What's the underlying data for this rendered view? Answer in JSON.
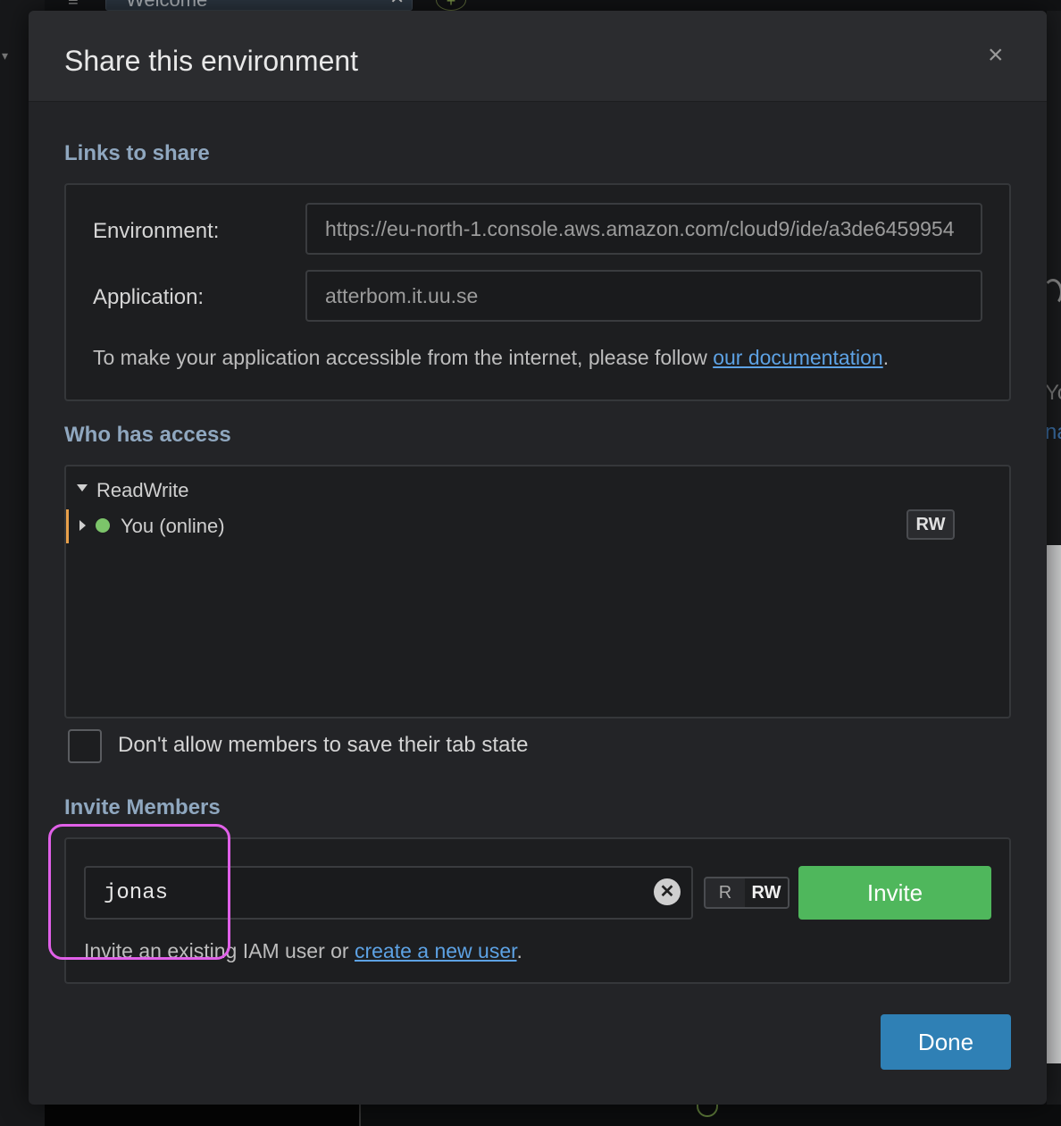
{
  "background": {
    "tab_title": "Welcome",
    "tab_close": "✕",
    "new_tab_symbol": "+",
    "right_text_1": "Yo",
    "right_text_2": "na"
  },
  "dialog": {
    "title": "Share this environment",
    "close_symbol": "×"
  },
  "links_section": {
    "title": "Links to share",
    "environment_label": "Environment:",
    "environment_value": "https://eu-north-1.console.aws.amazon.com/cloud9/ide/a3de6459954",
    "application_label": "Application:",
    "application_value": "atterbom.it.uu.se",
    "note_prefix": "To make your application accessible from the internet, please follow ",
    "note_link": "our documentation",
    "note_suffix": "."
  },
  "access_section": {
    "title": "Who has access",
    "group_label": "ReadWrite",
    "members": [
      {
        "name": "You (online)",
        "status_color": "#7cc46a",
        "permission": "RW"
      }
    ]
  },
  "tab_state_option": {
    "label": "Don't allow members to save their tab state",
    "checked": false
  },
  "invite_section": {
    "title": "Invite Members",
    "input_value": "jonas",
    "clear_symbol": "✕",
    "perm_r": "R",
    "perm_rw": "RW",
    "selected_permission": "RW",
    "invite_label": "Invite",
    "note_prefix": "Invite an existing IAM user or ",
    "note_link": "create a new user",
    "note_suffix": "."
  },
  "footer": {
    "done_label": "Done"
  },
  "colors": {
    "accent_green": "#4fb75c",
    "accent_blue": "#2f80b5",
    "link": "#5da2e4",
    "section_title": "#8fa7bf",
    "highlight": "#e060e8"
  }
}
